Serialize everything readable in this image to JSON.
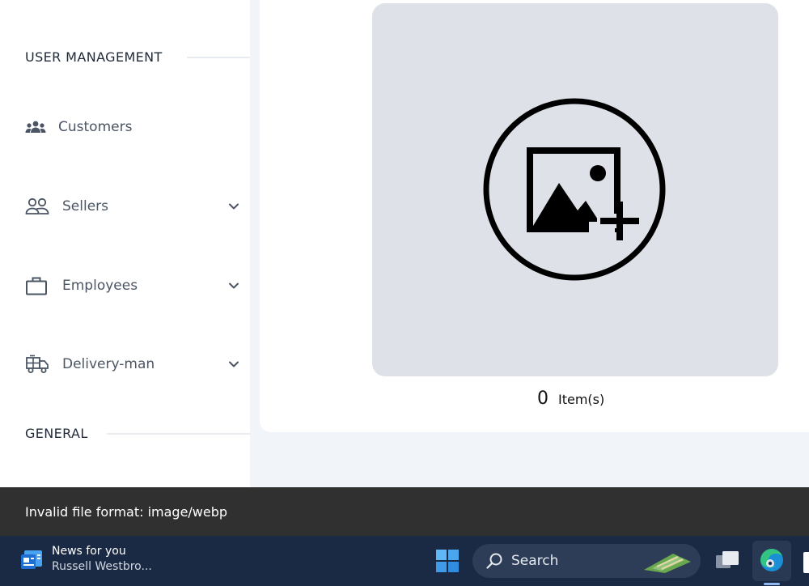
{
  "sidebar": {
    "sections": {
      "user_management": "USER MANAGEMENT",
      "general": "GENERAL"
    },
    "items": [
      {
        "label": "Customers",
        "icon": "users-group-icon",
        "has_dropdown": false
      },
      {
        "label": "Sellers",
        "icon": "user-pair-icon",
        "has_dropdown": true
      },
      {
        "label": "Employees",
        "icon": "briefcase-icon",
        "has_dropdown": true
      },
      {
        "label": "Delivery-man",
        "icon": "delivery-truck-icon",
        "has_dropdown": true
      }
    ]
  },
  "upload": {
    "icon": "add-image-icon",
    "count": "0",
    "count_label": "Item(s)"
  },
  "toast": {
    "message": "Invalid file format: image/webp"
  },
  "taskbar": {
    "news_title": "News for you",
    "news_subtitle": "Russell Westbro...",
    "search_label": "Search"
  },
  "colors": {
    "sidebar_bg": "#ffffff",
    "page_bg": "#f1f4f9",
    "upload_box": "#dee2e8",
    "toast_bg": "#303030",
    "taskbar_bg": "#1b2a44"
  }
}
